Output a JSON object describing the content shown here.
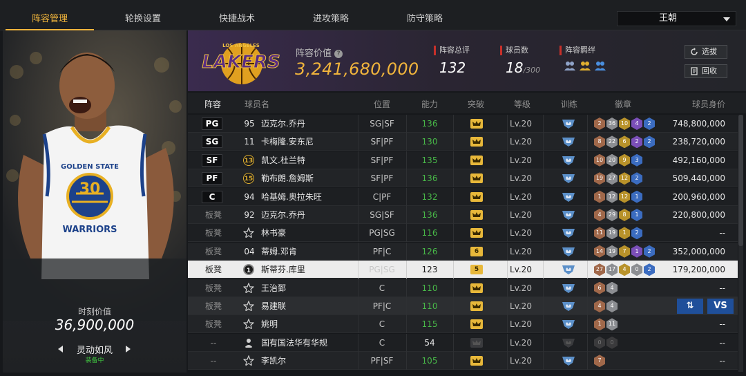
{
  "tabs": [
    {
      "label": "阵容管理",
      "active": true
    },
    {
      "label": "轮换设置",
      "active": false
    },
    {
      "label": "快捷战术",
      "active": false
    },
    {
      "label": "进攻策略",
      "active": false
    },
    {
      "label": "防守策略",
      "active": false
    }
  ],
  "dynasty_select": {
    "value": "王朝"
  },
  "hero": {
    "jersey_number": "30",
    "jersey_team": "GOLDEN STATE",
    "jersey_name": "WARRIORS",
    "value_label": "时刻价值",
    "value": "36,900,000",
    "skill_name": "灵动如风",
    "equipped": "装备中"
  },
  "header": {
    "team_logo_text": "LAKERS",
    "team_logo_city": "LOS ANGELES",
    "lineup_value_label": "阵容价值",
    "lineup_value": "3,241,680,000",
    "rating_label": "阵容总评",
    "rating": "132",
    "players_label": "球员数",
    "players_count": "18",
    "players_max": "/300",
    "bond_label": "阵容羁绊",
    "select_btn": "选拔",
    "recycle_btn": "回收"
  },
  "columns": [
    "阵容",
    "球员名",
    "位置",
    "能力",
    "突破",
    "等级",
    "训练",
    "徽章",
    "球员身价"
  ],
  "rows": [
    {
      "slot": "PG",
      "starter": true,
      "num": "95",
      "num_style": "plain",
      "name": "迈克尔.乔丹",
      "pos": "SG|SF",
      "rating": "136",
      "breakout": "",
      "level": "Lv.20",
      "badges": [
        [
          "bronze",
          "2"
        ],
        [
          "silver",
          "36"
        ],
        [
          "gold",
          "10"
        ],
        [
          "purple",
          "4"
        ],
        [
          "blue",
          "2"
        ]
      ],
      "worth": "748,800,000"
    },
    {
      "slot": "SG",
      "starter": true,
      "num": "11",
      "num_style": "plain",
      "name": "卡梅隆.安东尼",
      "pos": "SF|PF",
      "rating": "130",
      "breakout": "",
      "level": "Lv.20",
      "badges": [
        [
          "bronze",
          "8"
        ],
        [
          "silver",
          "22"
        ],
        [
          "gold",
          "6"
        ],
        [
          "purple",
          "2"
        ],
        [
          "blue",
          "2"
        ]
      ],
      "worth": "238,720,000"
    },
    {
      "slot": "SF",
      "starter": true,
      "num": "13",
      "num_style": "gold",
      "name": "凯文.杜兰特",
      "pos": "SF|PF",
      "rating": "135",
      "breakout": "",
      "level": "Lv.20",
      "badges": [
        [
          "bronze",
          "10"
        ],
        [
          "silver",
          "20"
        ],
        [
          "gold",
          "9"
        ],
        [
          "blue",
          "3"
        ]
      ],
      "worth": "492,160,000"
    },
    {
      "slot": "PF",
      "starter": true,
      "num": "15",
      "num_style": "gold",
      "name": "勒布朗.詹姆斯",
      "pos": "SF|PF",
      "rating": "136",
      "breakout": "",
      "level": "Lv.20",
      "badges": [
        [
          "bronze",
          "19"
        ],
        [
          "silver",
          "27"
        ],
        [
          "gold",
          "12"
        ],
        [
          "blue",
          "2"
        ]
      ],
      "worth": "509,440,000"
    },
    {
      "slot": "C",
      "starter": true,
      "num": "94",
      "num_style": "plain",
      "name": "哈基姆.奥拉朱旺",
      "pos": "C|PF",
      "rating": "132",
      "breakout": "",
      "level": "Lv.20",
      "badges": [
        [
          "bronze",
          "1"
        ],
        [
          "silver",
          "12"
        ],
        [
          "gold",
          "12"
        ],
        [
          "blue",
          "1"
        ]
      ],
      "worth": "200,960,000"
    },
    {
      "slot": "板凳",
      "starter": false,
      "num": "92",
      "num_style": "plain",
      "name": "迈克尔.乔丹",
      "pos": "SG|SF",
      "rating": "136",
      "breakout": "",
      "level": "Lv.20",
      "badges": [
        [
          "bronze",
          "4"
        ],
        [
          "silver",
          "29"
        ],
        [
          "gold",
          "8"
        ],
        [
          "blue",
          "1"
        ]
      ],
      "worth": "220,800,000"
    },
    {
      "slot": "板凳",
      "starter": false,
      "num": "",
      "num_style": "star",
      "name": "林书豪",
      "pos": "PG|SG",
      "rating": "116",
      "breakout": "",
      "level": "Lv.20",
      "badges": [
        [
          "bronze",
          "11"
        ],
        [
          "silver",
          "19"
        ],
        [
          "gold",
          "1"
        ],
        [
          "blue",
          "2"
        ]
      ],
      "worth": "--"
    },
    {
      "slot": "板凳",
      "starter": false,
      "num": "04",
      "num_style": "plain",
      "name": "蒂姆.邓肯",
      "pos": "PF|C",
      "rating": "126",
      "breakout": "6",
      "level": "Lv.20",
      "badges": [
        [
          "bronze",
          "14"
        ],
        [
          "silver",
          "19"
        ],
        [
          "gold",
          "7"
        ],
        [
          "purple",
          "1"
        ],
        [
          "blue",
          "2"
        ]
      ],
      "worth": "352,000,000"
    },
    {
      "slot": "板凳",
      "starter": false,
      "num": "1",
      "num_style": "dark",
      "name": "斯蒂芬.库里",
      "pos": "PG|SG",
      "rating": "123",
      "breakout": "5",
      "level": "Lv.20",
      "badges": [
        [
          "bronze",
          "27"
        ],
        [
          "silver",
          "17"
        ],
        [
          "gold",
          "4"
        ],
        [
          "silver",
          "0"
        ],
        [
          "blue",
          "2"
        ]
      ],
      "worth": "179,200,000",
      "selected": true
    },
    {
      "slot": "板凳",
      "starter": false,
      "num": "",
      "num_style": "star",
      "name": "王治郅",
      "pos": "C",
      "rating": "110",
      "breakout": "",
      "level": "Lv.20",
      "badges": [
        [
          "bronze",
          "6"
        ],
        [
          "silver",
          "4"
        ]
      ],
      "worth": "--"
    },
    {
      "slot": "板凳",
      "starter": false,
      "num": "",
      "num_style": "star",
      "name": "易建联",
      "pos": "PF|C",
      "rating": "110",
      "breakout": "",
      "level": "Lv.20",
      "badges": [
        [
          "bronze",
          "4"
        ],
        [
          "silver",
          "4"
        ]
      ],
      "worth": "",
      "hover": true
    },
    {
      "slot": "板凳",
      "starter": false,
      "num": "",
      "num_style": "star",
      "name": "姚明",
      "pos": "C",
      "rating": "115",
      "breakout": "",
      "level": "Lv.20",
      "badges": [
        [
          "bronze",
          "1"
        ],
        [
          "silver",
          "11"
        ]
      ],
      "worth": "--"
    },
    {
      "slot": "--",
      "starter": false,
      "num": "",
      "num_style": "person",
      "name": "国有国法华有华规",
      "pos": "C",
      "rating": "54",
      "rating_plain": true,
      "breakout": "",
      "breakout_dim": true,
      "level": "Lv.20",
      "train_dim": true,
      "badges": [
        [
          "dim",
          "0"
        ],
        [
          "dim",
          "0"
        ]
      ],
      "worth": "--"
    },
    {
      "slot": "--",
      "starter": false,
      "num": "",
      "num_style": "star",
      "name": "李凯尔",
      "pos": "PF|SF",
      "rating": "105",
      "breakout": "",
      "level": "Lv.20",
      "badges": [
        [
          "bronze",
          "7"
        ]
      ],
      "worth": "--"
    }
  ],
  "action_buttons": {
    "swap": "⇅",
    "vs": "VS"
  },
  "colors": {
    "accent": "#f0b43c",
    "rating_green": "#48b848",
    "equipped_green": "#3fbf3f",
    "stat_marker": "#c8302a"
  }
}
